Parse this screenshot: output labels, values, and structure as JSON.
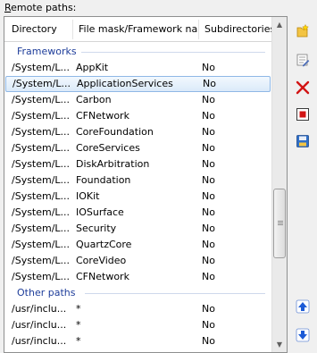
{
  "label": {
    "first": "R",
    "rest": "emote paths:"
  },
  "columns": [
    "Directory",
    "File mask/Framework name",
    "Subdirectories"
  ],
  "groups": [
    {
      "name": "Frameworks",
      "rows": [
        {
          "dir": "/System/L...",
          "name": "AppKit",
          "sub": "No"
        },
        {
          "dir": "/System/L...",
          "name": "ApplicationServices",
          "sub": "No",
          "selected": true
        },
        {
          "dir": "/System/L...",
          "name": "Carbon",
          "sub": "No"
        },
        {
          "dir": "/System/L...",
          "name": "CFNetwork",
          "sub": "No"
        },
        {
          "dir": "/System/L...",
          "name": "CoreFoundation",
          "sub": "No"
        },
        {
          "dir": "/System/L...",
          "name": "CoreServices",
          "sub": "No"
        },
        {
          "dir": "/System/L...",
          "name": "DiskArbitration",
          "sub": "No"
        },
        {
          "dir": "/System/L...",
          "name": "Foundation",
          "sub": "No"
        },
        {
          "dir": "/System/L...",
          "name": "IOKit",
          "sub": "No"
        },
        {
          "dir": "/System/L...",
          "name": "IOSurface",
          "sub": "No"
        },
        {
          "dir": "/System/L...",
          "name": "Security",
          "sub": "No"
        },
        {
          "dir": "/System/L...",
          "name": "QuartzCore",
          "sub": "No"
        },
        {
          "dir": "/System/L...",
          "name": "CoreVideo",
          "sub": "No"
        },
        {
          "dir": "/System/L...",
          "name": "CFNetwork",
          "sub": "No"
        }
      ]
    },
    {
      "name": "Other paths",
      "rows": [
        {
          "dir": "/usr/inclu...",
          "name": "*",
          "sub": "No"
        },
        {
          "dir": "/usr/inclu...",
          "name": "*",
          "sub": "No"
        },
        {
          "dir": "/usr/inclu...",
          "name": "*",
          "sub": "No"
        }
      ]
    }
  ],
  "toolbar": [
    {
      "id": "add",
      "icon": "add-path-icon"
    },
    {
      "id": "edit",
      "icon": "edit-path-icon"
    },
    {
      "id": "delete",
      "icon": "delete-icon"
    },
    {
      "id": "stop",
      "icon": "stop-icon"
    },
    {
      "id": "save",
      "icon": "save-icon"
    },
    {
      "id": "up",
      "icon": "move-up-icon"
    },
    {
      "id": "down",
      "icon": "move-down-icon"
    }
  ],
  "colors": {
    "group_text": "#1e3d9a",
    "selection_border": "#8fb8e6",
    "accent": "#1d5bd6"
  }
}
